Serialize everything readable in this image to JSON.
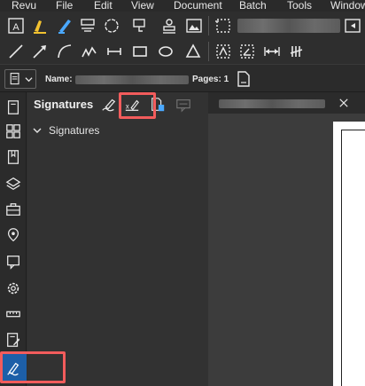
{
  "menu": [
    "Revu",
    "File",
    "Edit",
    "View",
    "Document",
    "Batch",
    "Tools",
    "Window"
  ],
  "docbar": {
    "name_label": "Name:",
    "pages_label": "Pages: 1"
  },
  "panel": {
    "title": "Signatures",
    "tree_item": "Signatures"
  },
  "colors": {
    "accent": "#1d5fa8",
    "highlight": "#f25c5c",
    "pen": "#4aa8ff"
  }
}
